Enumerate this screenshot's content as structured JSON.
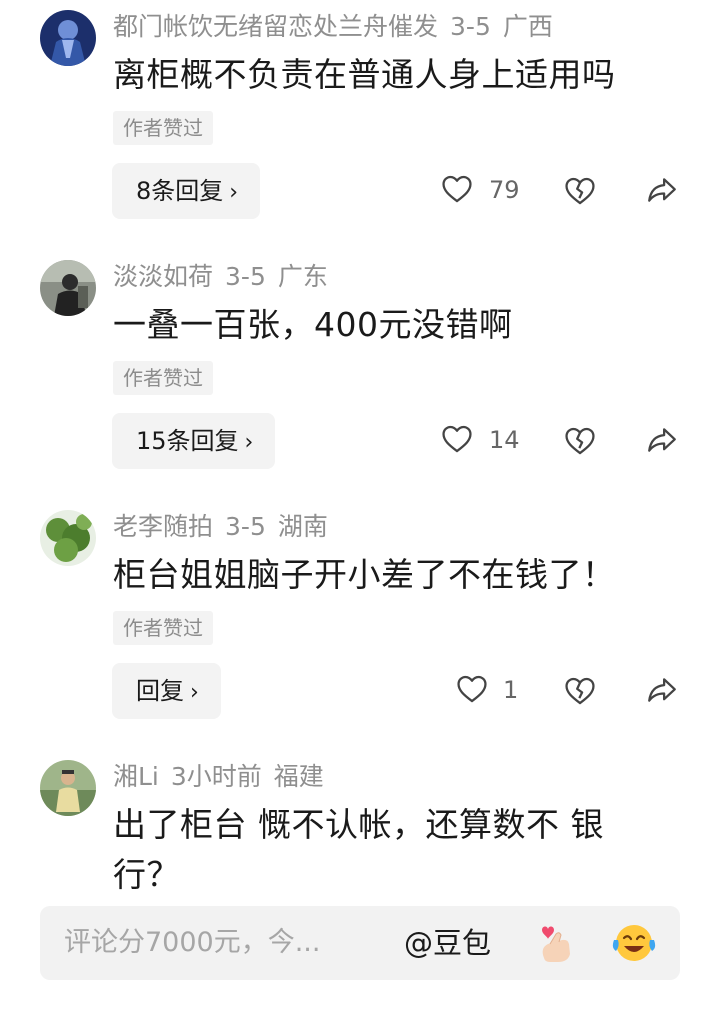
{
  "comments": [
    {
      "user": "都门帐饮无绪留恋处兰舟催发",
      "date": "3-5",
      "location": "广西",
      "text": "离柜概不负责在普通人身上适用吗",
      "author_tag": "作者赞过",
      "reply_label": "8条回复",
      "likes": "79"
    },
    {
      "user": "淡淡如荷",
      "date": "3-5",
      "location": "广东",
      "text": "一叠一百张，400元没错啊",
      "author_tag": "作者赞过",
      "reply_label": "15条回复",
      "likes": "14"
    },
    {
      "user": "老李随拍",
      "date": "3-5",
      "location": "湖南",
      "text": "柜台姐姐脑子开小差了不在钱了！",
      "author_tag": "作者赞过",
      "reply_label": "回复",
      "likes": "1"
    },
    {
      "user": "湘Li",
      "date": "3小时前",
      "location": "福建",
      "text_line1": "出了柜台 慨不认帐，还算数不 银",
      "text_line2": "行？"
    }
  ],
  "input_bar": {
    "placeholder": "评论分7000元，今...",
    "at_label": "@豆包"
  },
  "colors": {
    "meta_gray": "#8f8f8f",
    "tag_bg": "#f3f3f3",
    "icon_gray": "#444444"
  }
}
